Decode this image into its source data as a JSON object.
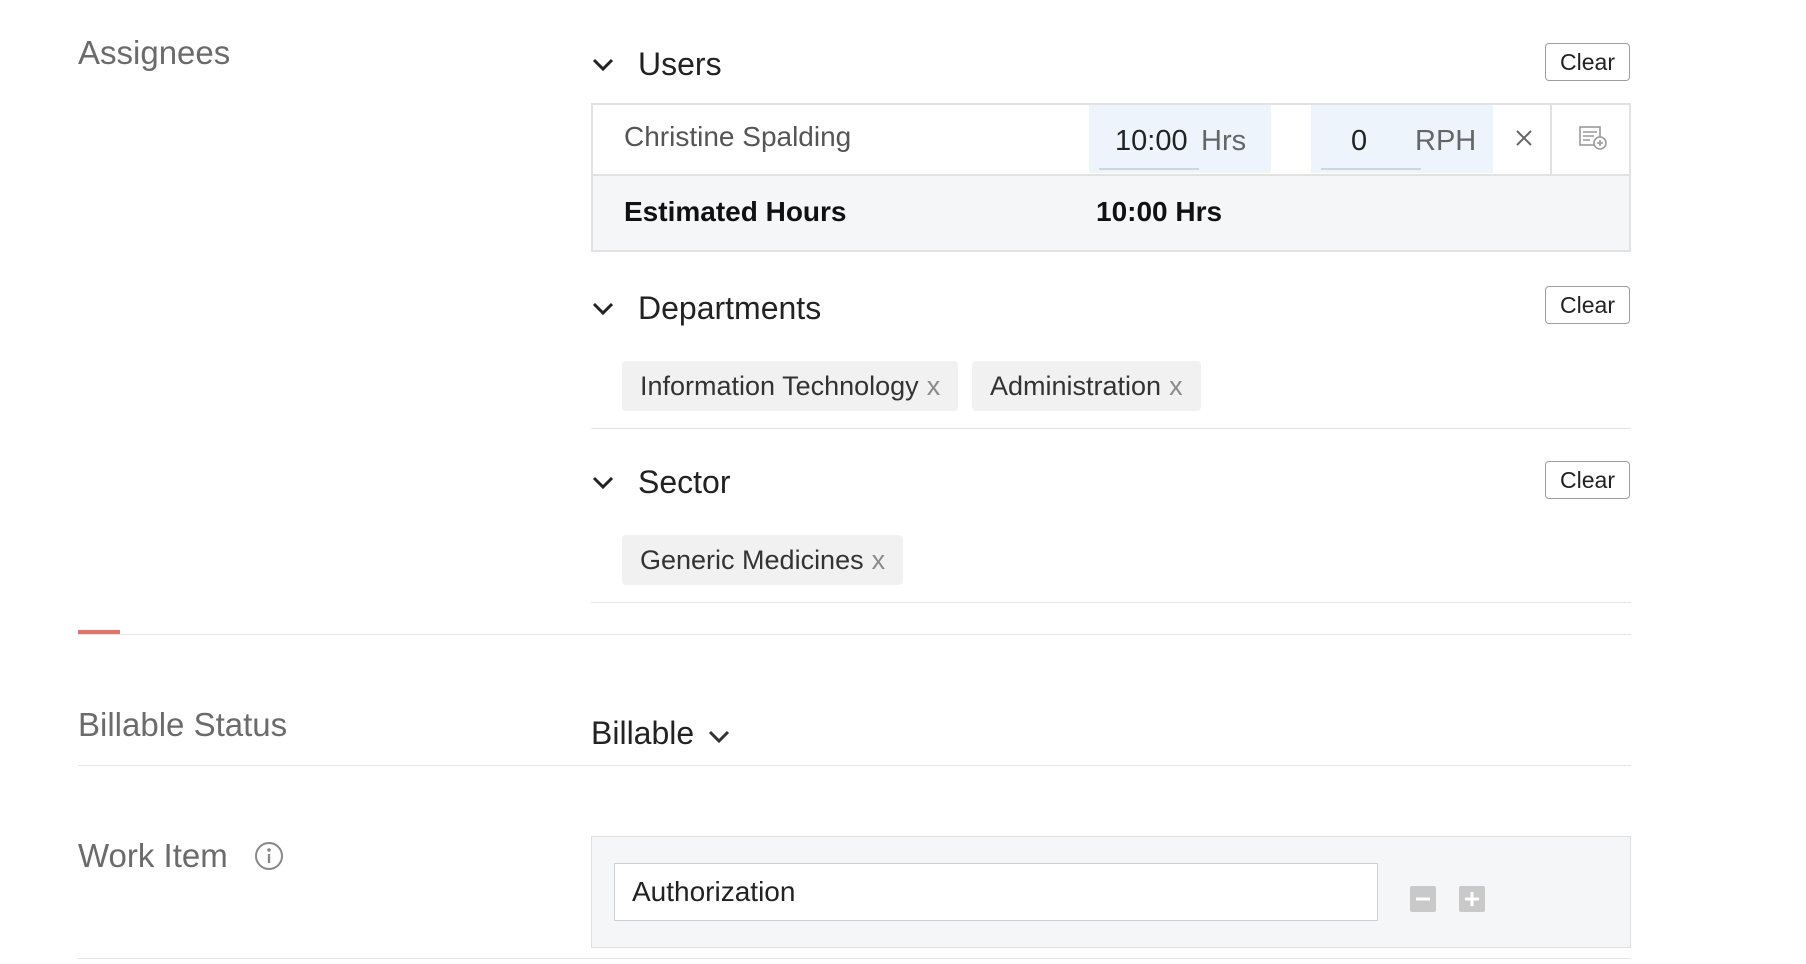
{
  "assignees": {
    "label": "Assignees",
    "users": {
      "title": "Users",
      "clear_label": "Clear",
      "rows": [
        {
          "name": "Christine Spalding",
          "hours": "10:00",
          "hours_unit": "Hrs",
          "rate": "0",
          "rate_unit": "RPH"
        }
      ],
      "estimated_label": "Estimated Hours",
      "estimated_value": "10:00 Hrs"
    },
    "departments": {
      "title": "Departments",
      "clear_label": "Clear",
      "chips": [
        "Information Technology",
        "Administration"
      ]
    },
    "sector": {
      "title": "Sector",
      "clear_label": "Clear",
      "chips": [
        "Generic Medicines"
      ]
    },
    "chip_remove": "x"
  },
  "billable": {
    "label": "Billable Status",
    "value": "Billable"
  },
  "work_item": {
    "label": "Work Item",
    "value": "Authorization"
  },
  "colors": {
    "accent_red": "#e57368",
    "panel_bg": "#f5f6f8",
    "field_bg": "#eef4fb"
  }
}
